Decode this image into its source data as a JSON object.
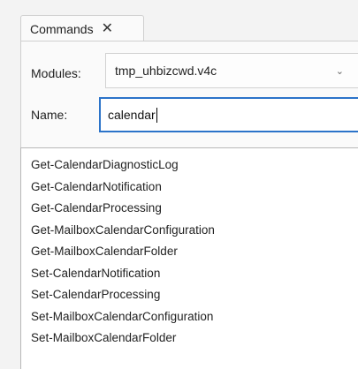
{
  "tab": {
    "label": "Commands",
    "close_glyph": "✕"
  },
  "form": {
    "modules_label": "Modules:",
    "modules_value": "tmp_uhbizcwd.v4c",
    "name_label": "Name:",
    "name_value": "calendar"
  },
  "commands": [
    "Get-CalendarDiagnosticLog",
    "Get-CalendarNotification",
    "Get-CalendarProcessing",
    "Get-MailboxCalendarConfiguration",
    "Get-MailboxCalendarFolder",
    "Set-CalendarNotification",
    "Set-CalendarProcessing",
    "Set-MailboxCalendarConfiguration",
    "Set-MailboxCalendarFolder"
  ],
  "colors": {
    "focus_border": "#2b73c9"
  }
}
